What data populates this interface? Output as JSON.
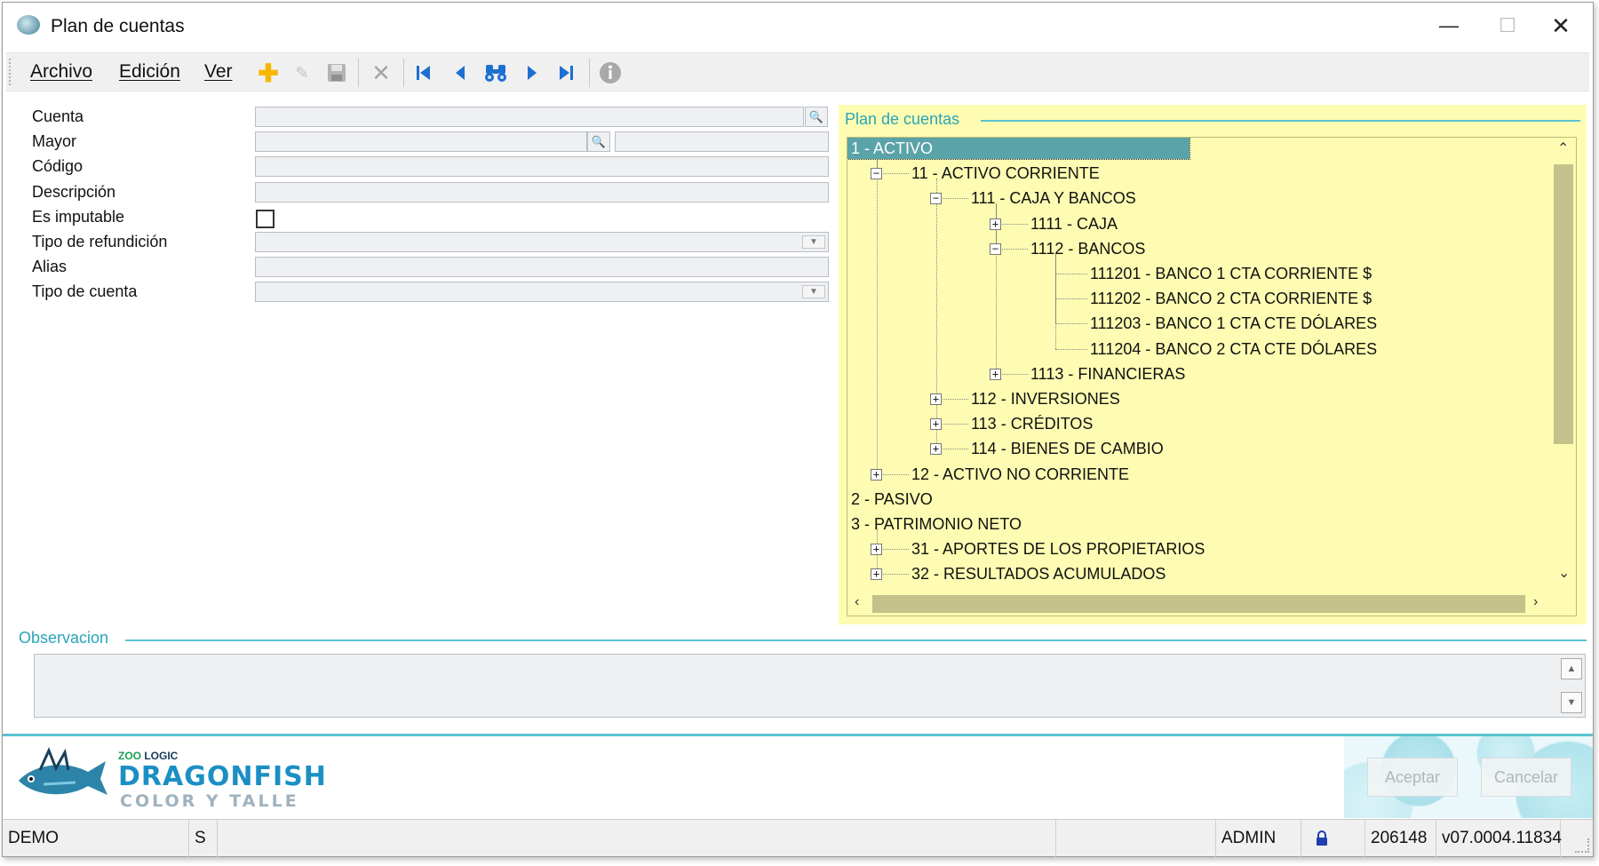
{
  "window": {
    "title": "Plan de cuentas",
    "minimize_glyph": "—",
    "maximize_glyph": "☐",
    "close_glyph": "✕"
  },
  "menu": {
    "items": [
      "Archivo",
      "Edición",
      "Ver"
    ]
  },
  "toolbar": {
    "icons": [
      "add-icon",
      "edit-icon",
      "save-icon",
      "delete-icon",
      "first-record-icon",
      "previous-record-icon",
      "search-binoculars-icon",
      "next-record-icon",
      "last-record-icon",
      "info-icon"
    ],
    "colors": {
      "add": "#f5b800",
      "nav": "#1e6fd0",
      "disabled": "#a6a6a6"
    }
  },
  "form": {
    "labels": {
      "cuenta": "Cuenta",
      "mayor": "Mayor",
      "codigo": "Código",
      "descripcion": "Descripción",
      "es_imputable": "Es imputable",
      "tipo_refundicion": "Tipo de refundición",
      "alias": "Alias",
      "tipo_cuenta": "Tipo de cuenta"
    },
    "values": {
      "cuenta": "",
      "mayor": "",
      "mayor_descripcion": "",
      "codigo": "",
      "descripcion": "",
      "es_imputable": false,
      "tipo_refundicion": "",
      "alias": "",
      "tipo_cuenta": ""
    }
  },
  "plan": {
    "heading": "Plan de cuentas",
    "nodes": [
      {
        "label": "1 - ACTIVO",
        "level": 0,
        "expander": "",
        "selected": true
      },
      {
        "label": "11 - ACTIVO CORRIENTE",
        "level": 1,
        "expander": "minus"
      },
      {
        "label": "111 - CAJA Y BANCOS",
        "level": 2,
        "expander": "minus"
      },
      {
        "label": "1111 - CAJA",
        "level": 3,
        "expander": "plus"
      },
      {
        "label": "1112 - BANCOS",
        "level": 3,
        "expander": "minus"
      },
      {
        "label": "111201 - BANCO 1 CTA CORRIENTE $",
        "level": 4,
        "expander": ""
      },
      {
        "label": "111202 - BANCO 2 CTA CORRIENTE $",
        "level": 4,
        "expander": ""
      },
      {
        "label": "111203 - BANCO 1 CTA CTE DÓLARES",
        "level": 4,
        "expander": ""
      },
      {
        "label": "111204 - BANCO 2 CTA CTE DÓLARES",
        "level": 4,
        "expander": ""
      },
      {
        "label": "1113 - FINANCIERAS",
        "level": 3,
        "expander": "plus"
      },
      {
        "label": "112 - INVERSIONES",
        "level": 2,
        "expander": "plus"
      },
      {
        "label": "113 - CRÉDITOS",
        "level": 2,
        "expander": "plus"
      },
      {
        "label": "114 - BIENES DE CAMBIO",
        "level": 2,
        "expander": "plus"
      },
      {
        "label": "12 - ACTIVO NO CORRIENTE",
        "level": 1,
        "expander": "plus"
      },
      {
        "label": "2 - PASIVO",
        "level": 0,
        "expander": ""
      },
      {
        "label": "3 - PATRIMONIO NETO",
        "level": 0,
        "expander": ""
      },
      {
        "label": "31 - APORTES DE LOS PROPIETARIOS",
        "level": 1,
        "expander": "plus"
      },
      {
        "label": "32 - RESULTADOS ACUMULADOS",
        "level": 1,
        "expander": "plus"
      }
    ],
    "colors": {
      "panel": "#fdfcb2",
      "selected": "#5aa3a9"
    }
  },
  "observacion": {
    "label": "Observacion",
    "value": ""
  },
  "footer": {
    "brand_small_prefix": "ZOO",
    "brand_small_suffix": "LOGIC",
    "brand_main": "DRAGONFISH",
    "brand_sub": "COLOR Y TALLE",
    "accept_label": "Aceptar",
    "cancel_label": "Cancelar"
  },
  "statusbar": {
    "database": "DEMO",
    "flag": "S",
    "user": "ADMIN",
    "lock_icon": "lock-icon",
    "serial": "206148",
    "version": "v07.0004.11834"
  }
}
